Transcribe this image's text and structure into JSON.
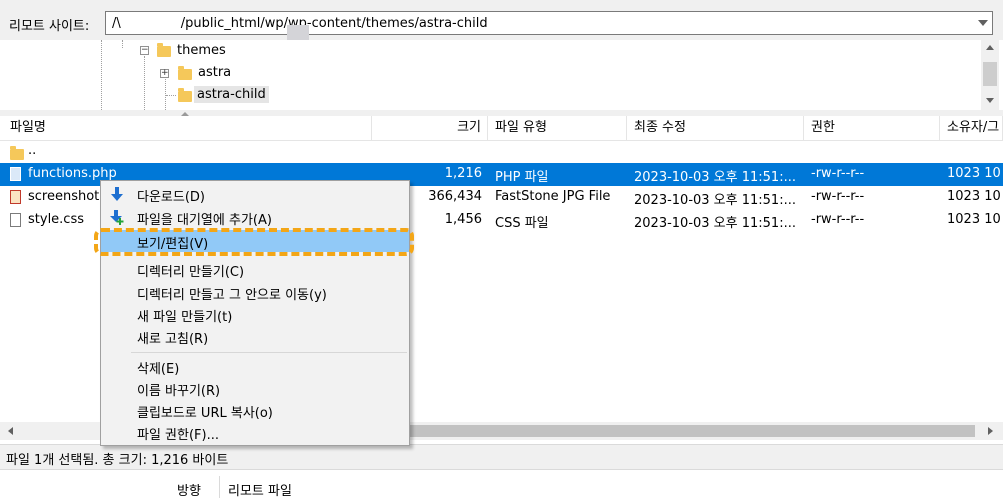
{
  "address": {
    "label": "리모트 사이트:",
    "path_prefix": "/\\",
    "path_rest": "/public_html/wp/wp-content/themes/astra-child"
  },
  "tree": {
    "items": [
      {
        "label": "themes",
        "expander": "−"
      },
      {
        "label": "astra",
        "expander": "+"
      },
      {
        "label": "astra-child",
        "expander": ""
      }
    ]
  },
  "columns": [
    "파일명",
    "크기",
    "파일 유형",
    "최종 수정",
    "권한",
    "소유자/그"
  ],
  "files": [
    {
      "name": "..",
      "size": "",
      "type": "",
      "modified": "",
      "perms": "",
      "owner": "",
      "selected": false,
      "icon": "folder-icon"
    },
    {
      "name": "functions.php",
      "size": "1,216",
      "type": "PHP 파일",
      "modified": "2023-10-03 오후 11:51:...",
      "perms": "-rw-r--r--",
      "owner": "1023 10",
      "selected": true,
      "icon": "php-file-icon"
    },
    {
      "name": "screenshot.jpg",
      "size": "366,434",
      "type": "FastStone JPG File",
      "modified": "2023-10-03 오후 11:51:...",
      "perms": "-rw-r--r--",
      "owner": "1023 10",
      "selected": false,
      "icon": "jpg-file-icon"
    },
    {
      "name": "style.css",
      "size": "1,456",
      "type": "CSS 파일",
      "modified": "2023-10-03 오후 11:51:...",
      "perms": "-rw-r--r--",
      "owner": "1023 10",
      "selected": false,
      "icon": "css-file-icon"
    }
  ],
  "context_menu": {
    "items": [
      {
        "label": "다운로드(D)",
        "icon": "download-icon"
      },
      {
        "label": "파일을 대기열에 추가(A)",
        "icon": "add-to-queue-icon"
      },
      {
        "label": "보기/편집(V)",
        "icon": ""
      },
      {
        "label": "디렉터리 만들기(C)",
        "icon": ""
      },
      {
        "label": "디렉터리 만들고 그 안으로 이동(y)",
        "icon": ""
      },
      {
        "label": "새 파일 만들기(t)",
        "icon": ""
      },
      {
        "label": "새로 고침(R)",
        "icon": ""
      },
      {
        "label": "삭제(E)",
        "icon": ""
      },
      {
        "label": "이름 바꾸기(R)",
        "icon": ""
      },
      {
        "label": "클립보드로 URL 복사(o)",
        "icon": ""
      },
      {
        "label": "파일 권한(F)...",
        "icon": ""
      }
    ],
    "highlighted_index": 2
  },
  "status": {
    "text": "파일 1개 선택됨. 총 크기: 1,216 바이트"
  },
  "queue_tabs": {
    "direction": "방향",
    "remote_file": "리모트 파일"
  },
  "colors": {
    "selection": "#0078d7",
    "menu_highlight": "#91c9f7",
    "annotation": "#f3a617"
  }
}
